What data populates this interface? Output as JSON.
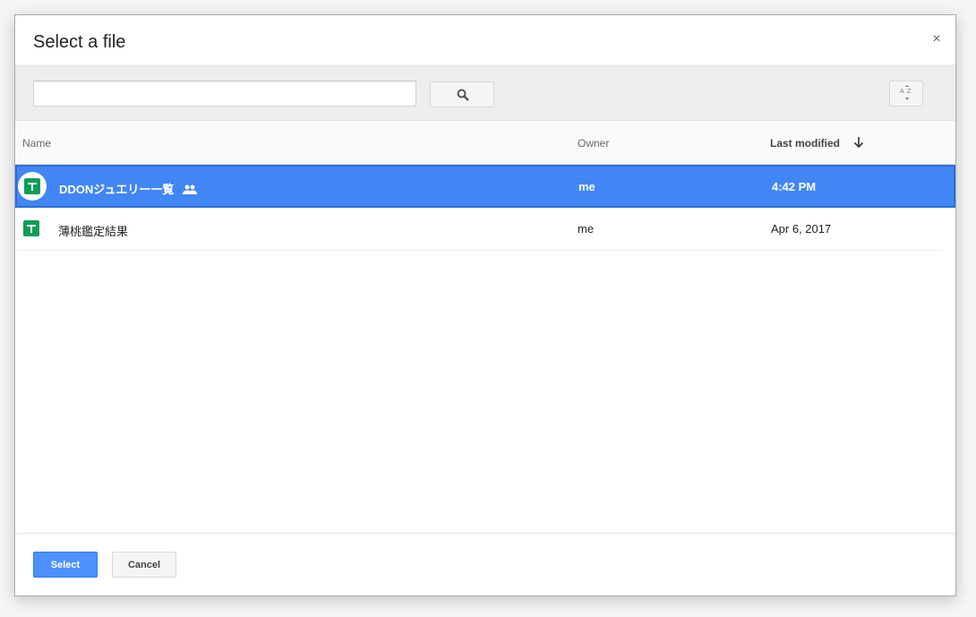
{
  "dialog": {
    "title": "Select a file",
    "close_label": "×"
  },
  "toolbar": {
    "search_value": "",
    "search_placeholder": "",
    "search_icon": "search-icon",
    "sort_icon": "sort-az-icon"
  },
  "table": {
    "headers": {
      "name": "Name",
      "owner": "Owner",
      "modified": "Last modified"
    },
    "sort_direction_icon": "arrow-down-icon",
    "rows": [
      {
        "name": "DDONジュエリー一覧",
        "owner": "me",
        "modified": "4:42 PM",
        "icon": "sheets-icon",
        "shared": true,
        "selected": true
      },
      {
        "name": "薄桃鑑定結果",
        "owner": "me",
        "modified": "Apr 6, 2017",
        "icon": "sheets-icon",
        "shared": false,
        "selected": false
      }
    ]
  },
  "footer": {
    "select_label": "Select",
    "cancel_label": "Cancel"
  },
  "colors": {
    "selected_row": "#4285f4",
    "sheets_green": "#0f9d58",
    "primary_button": "#4d90fe"
  }
}
